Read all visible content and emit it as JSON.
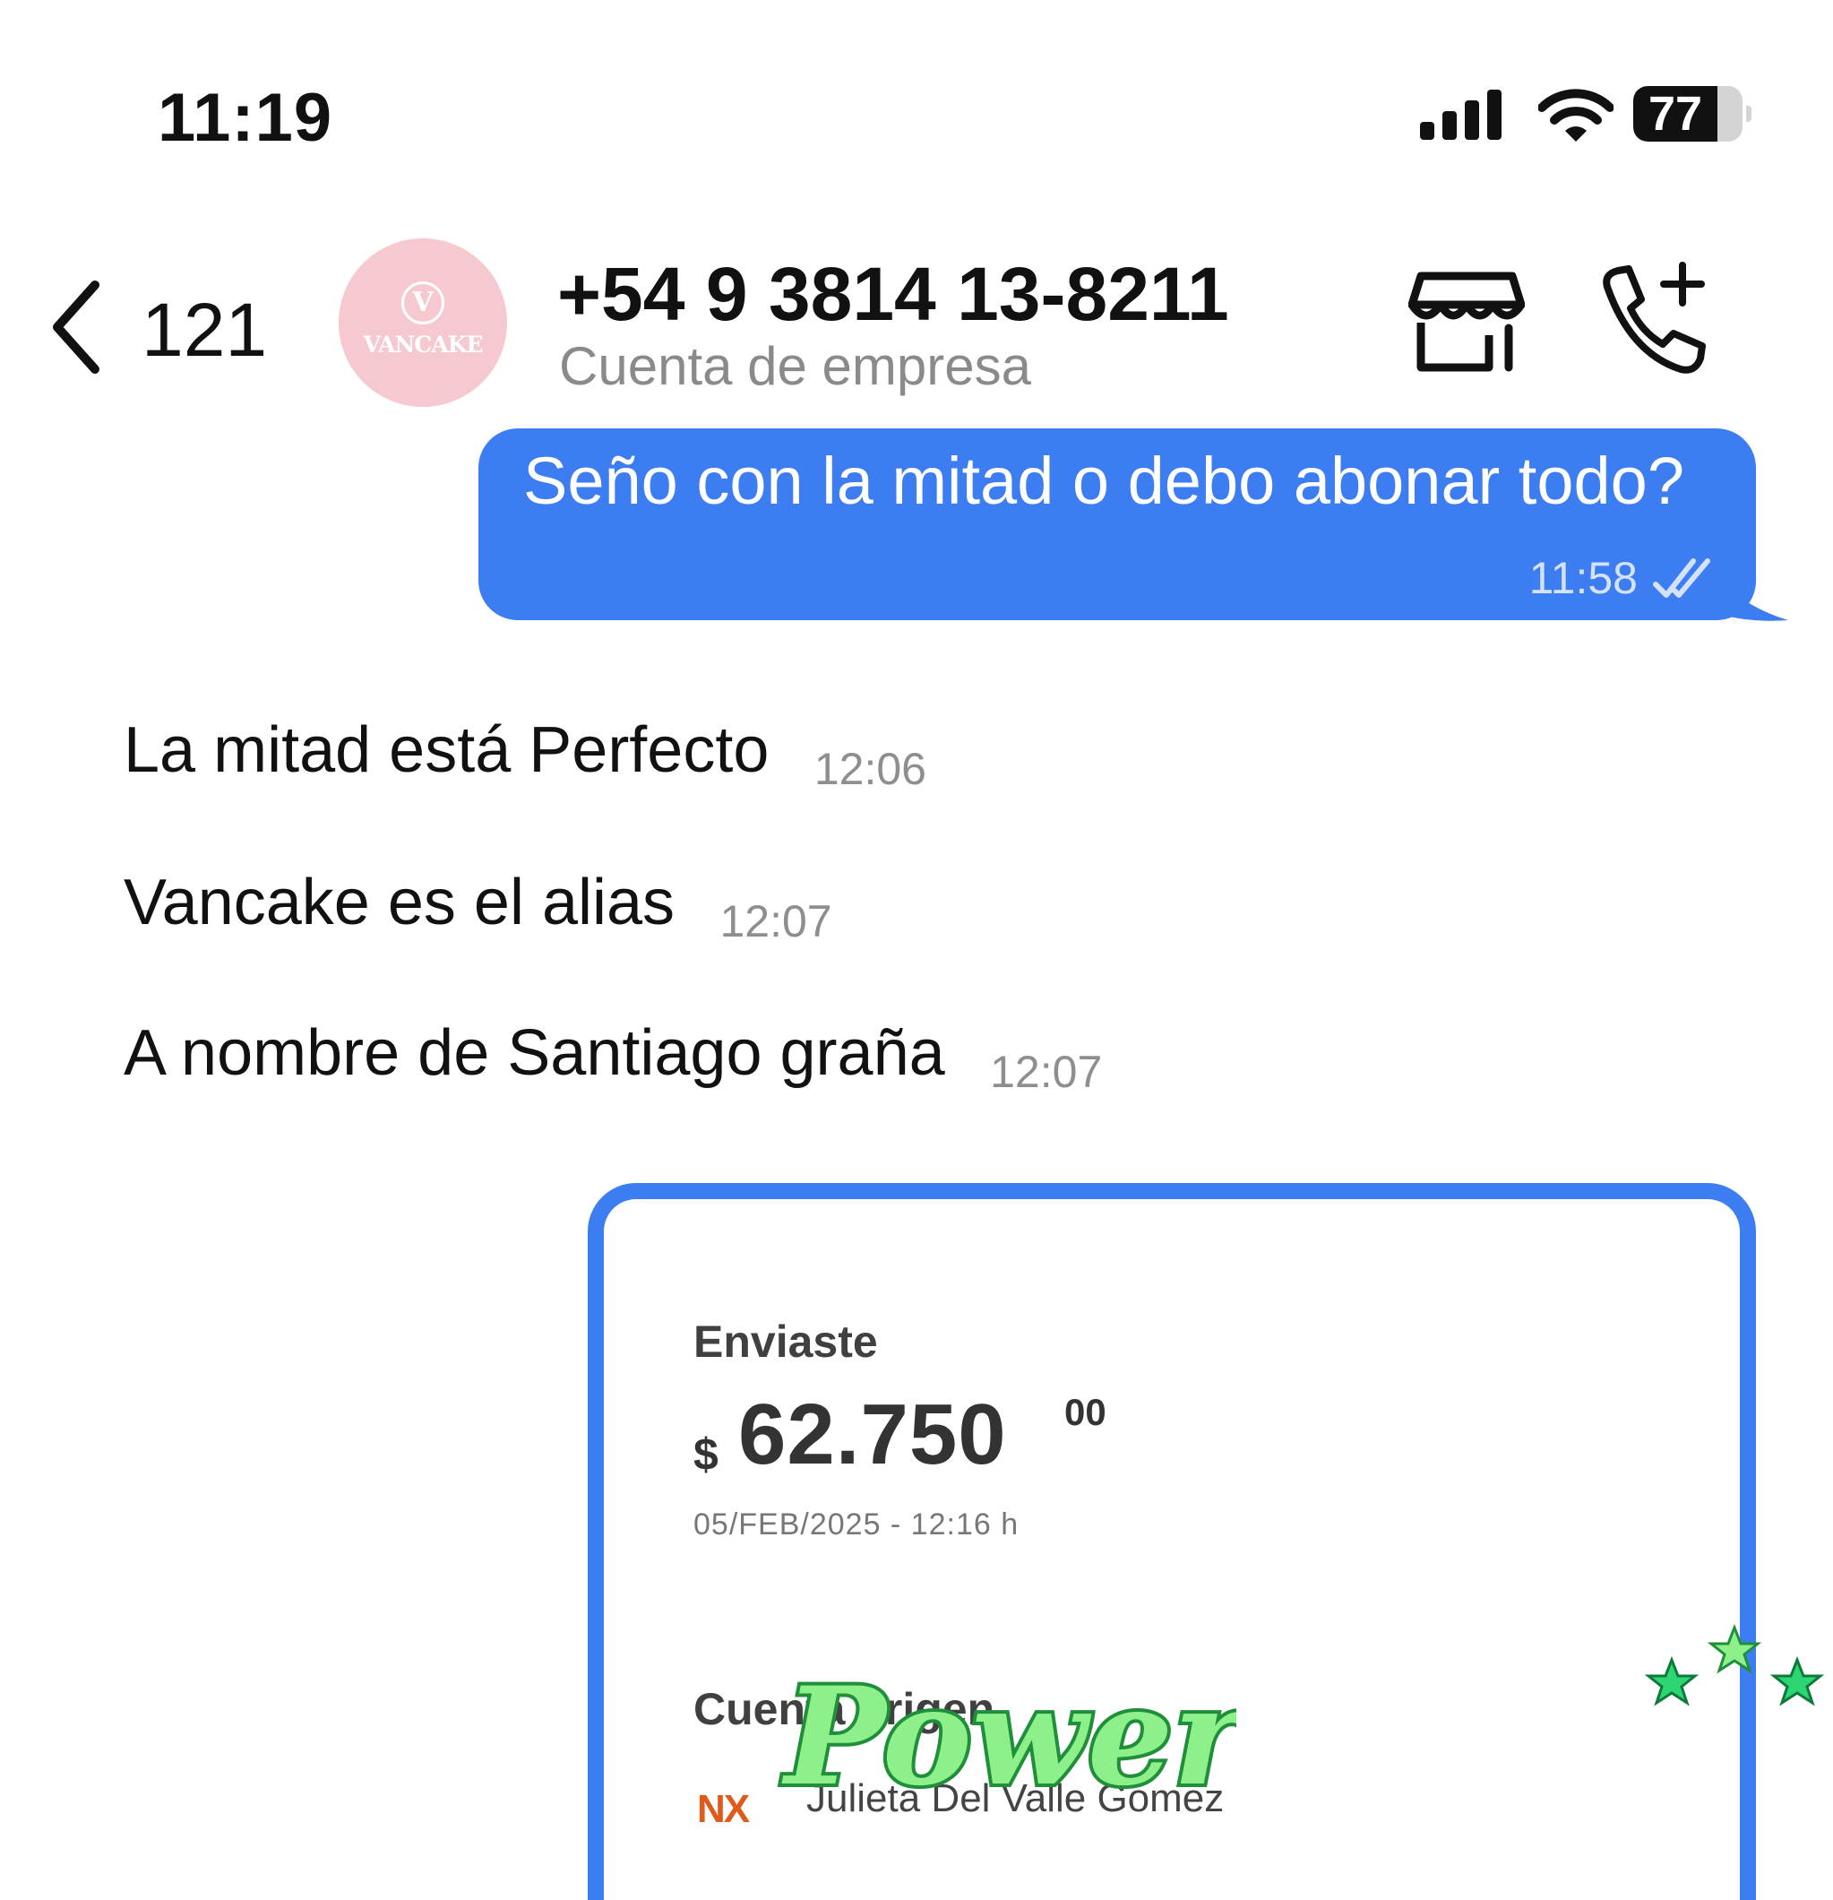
{
  "status_bar": {
    "time": "11:19",
    "battery": "77",
    "battery_level": 0.77
  },
  "header": {
    "back_count": "121",
    "contact_name": "+54 9 3814 13-8211",
    "contact_subtitle": "Cuenta de empresa",
    "avatar_initial": "V",
    "avatar_text": "VANCAKE"
  },
  "messages": {
    "outgoing": [
      {
        "text": "Seño con la mitad o debo abonar todo?",
        "time": "11:58"
      }
    ],
    "incoming": [
      {
        "text": "La mitad está Perfecto",
        "time": "12:06"
      },
      {
        "text": "Vancake es el alias",
        "time": "12:07"
      },
      {
        "text": "A nombre de Santiago graña",
        "time": "12:07"
      }
    ]
  },
  "receipt": {
    "label": "Enviaste",
    "currency": "$",
    "amount": "62.750",
    "cents": "00",
    "date": "05/FEB/2025 - 12:16 h",
    "origin_label": "Cuenta origen",
    "bank_logo": "NX",
    "account_holder": "Julieta Del Valle Gomez"
  },
  "sticker": {
    "text": "Power"
  },
  "colors": {
    "accent": "#3d7df2",
    "avatar_bg": "#f6c9d0",
    "sticker_green": "#8ef08a"
  },
  "icons": {
    "back": "chevron-left-icon",
    "store": "store-icon",
    "call": "add-call-icon",
    "read": "double-check-icon",
    "signal": "cellular-signal-icon",
    "wifi": "wifi-icon",
    "battery": "battery-icon"
  }
}
